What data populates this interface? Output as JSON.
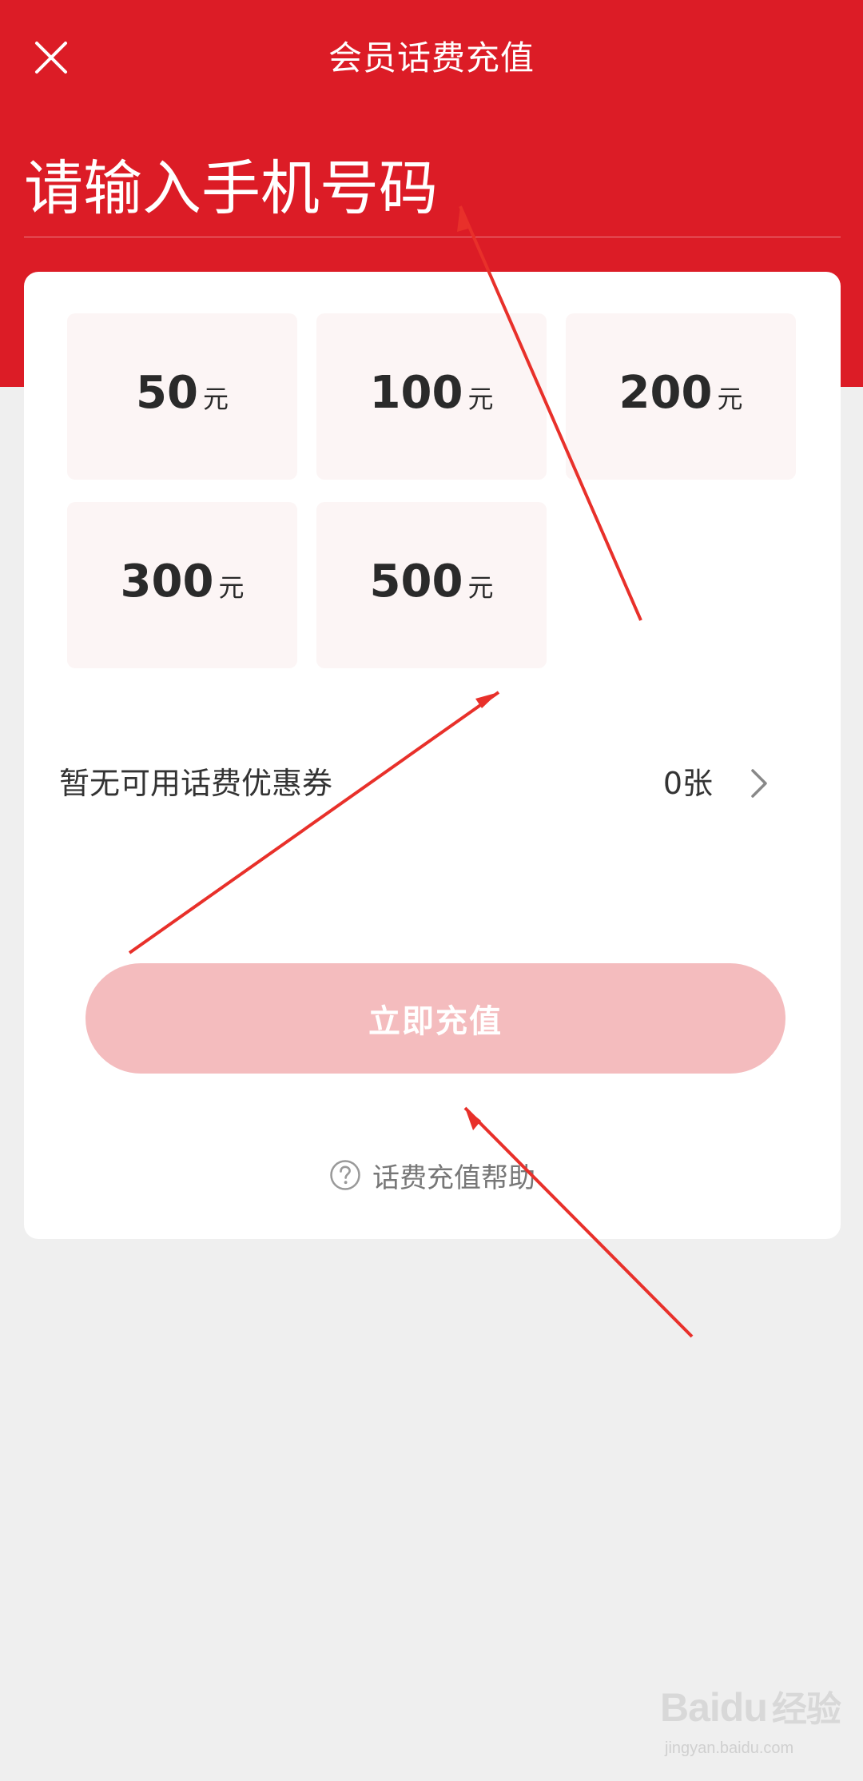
{
  "header": {
    "title": "会员话费充值",
    "phone_placeholder": "请输入手机号码"
  },
  "amounts": [
    {
      "value": "50",
      "unit": "元"
    },
    {
      "value": "100",
      "unit": "元"
    },
    {
      "value": "200",
      "unit": "元"
    },
    {
      "value": "300",
      "unit": "元"
    },
    {
      "value": "500",
      "unit": "元"
    }
  ],
  "coupon": {
    "label": "暂无可用话费优惠券",
    "count": "0张"
  },
  "submit_label": "立即充值",
  "help_label": "话费充值帮助",
  "watermark": {
    "logo": "Baidu",
    "suffix": "经验",
    "url": "jingyan.baidu.com"
  },
  "colors": {
    "brand_red": "#dc1c26",
    "button_disabled": "#f4bcbe",
    "tile_bg": "#fcf5f5",
    "page_bg": "#efefef",
    "annotation_arrow": "#e8302a"
  },
  "icons": {
    "close": "close-icon",
    "chevron": "chevron-right-icon",
    "help": "question-circle-icon"
  }
}
